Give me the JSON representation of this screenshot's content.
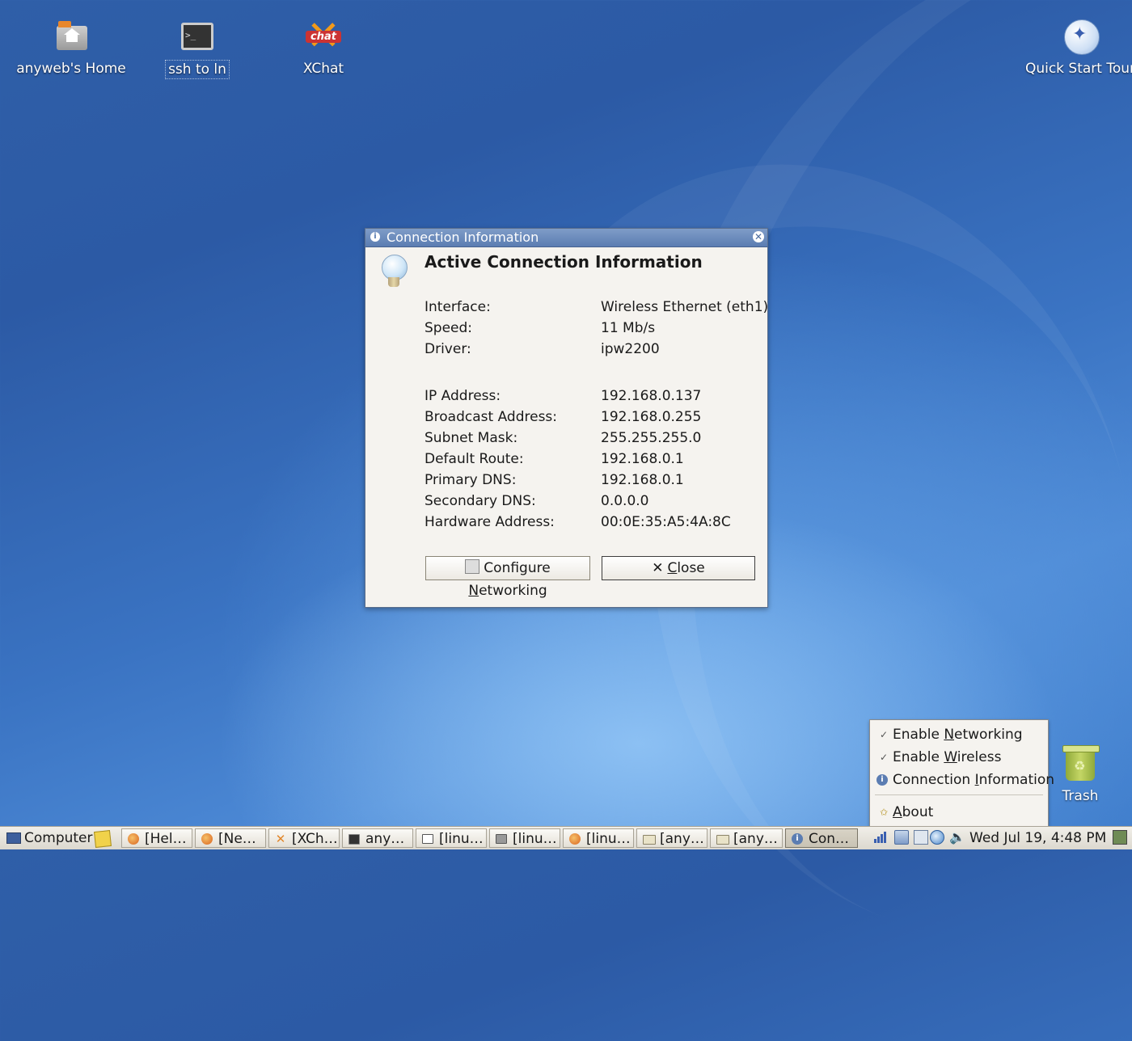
{
  "desktop": {
    "icons": [
      {
        "label": "anyweb's Home",
        "icon": "home-folder-icon"
      },
      {
        "label": "ssh to ln",
        "icon": "terminal-icon"
      },
      {
        "label": "XChat",
        "icon": "xchat-icon"
      },
      {
        "label": "Quick Start Tour",
        "icon": "quick-start-icon"
      },
      {
        "label": "Trash",
        "icon": "trash-icon"
      }
    ],
    "xchat_logo_text": "chat"
  },
  "dialog": {
    "title": "Connection Information",
    "heading": "Active Connection Information",
    "rows_top": [
      {
        "label": "Interface:",
        "value": "Wireless Ethernet (eth1)"
      },
      {
        "label": "Speed:",
        "value": "11 Mb/s"
      },
      {
        "label": "Driver:",
        "value": "ipw2200"
      }
    ],
    "rows_bottom": [
      {
        "label": "IP Address:",
        "value": "192.168.0.137"
      },
      {
        "label": "Broadcast Address:",
        "value": "192.168.0.255"
      },
      {
        "label": "Subnet Mask:",
        "value": "255.255.255.0"
      },
      {
        "label": "Default Route:",
        "value": "192.168.0.1"
      },
      {
        "label": "Primary DNS:",
        "value": "192.168.0.1"
      },
      {
        "label": "Secondary DNS:",
        "value": "0.0.0.0"
      },
      {
        "label": "Hardware Address:",
        "value": "00:0E:35:A5:4A:8C"
      }
    ],
    "configure_button": {
      "pre": "Configure ",
      "mnemonic": "N",
      "post": "etworking"
    },
    "close_button": {
      "pre": "",
      "mnemonic": "C",
      "post": "lose"
    }
  },
  "menu": {
    "items": [
      {
        "check": "✓",
        "pre": "Enable ",
        "mnemonic": "N",
        "post": "etworking"
      },
      {
        "check": "✓",
        "pre": "Enable ",
        "mnemonic": "W",
        "post": "ireless"
      },
      {
        "pre": "Connection ",
        "mnemonic": "I",
        "post": "nformation"
      },
      {
        "pre": "",
        "mnemonic": "A",
        "post": "bout"
      }
    ]
  },
  "taskbar": {
    "computer_label": "Computer",
    "tasks": [
      {
        "label": "[Hel…",
        "icon": "firefox-icon"
      },
      {
        "label": "[Ne…",
        "icon": "firefox-icon"
      },
      {
        "label": "[XCh…",
        "icon": "xchat-icon"
      },
      {
        "label": "any…",
        "icon": "terminal-icon"
      },
      {
        "label": "[linu…",
        "icon": "window-icon"
      },
      {
        "label": "[linu…",
        "icon": "window-icon"
      },
      {
        "label": "[linu…",
        "icon": "firefox-icon"
      },
      {
        "label": "[any…",
        "icon": "folder-icon"
      },
      {
        "label": "[any…",
        "icon": "folder-icon"
      },
      {
        "label": "Con…",
        "icon": "info-icon",
        "active": true
      }
    ],
    "clock": "Wed Jul 19,  4:48 PM"
  }
}
